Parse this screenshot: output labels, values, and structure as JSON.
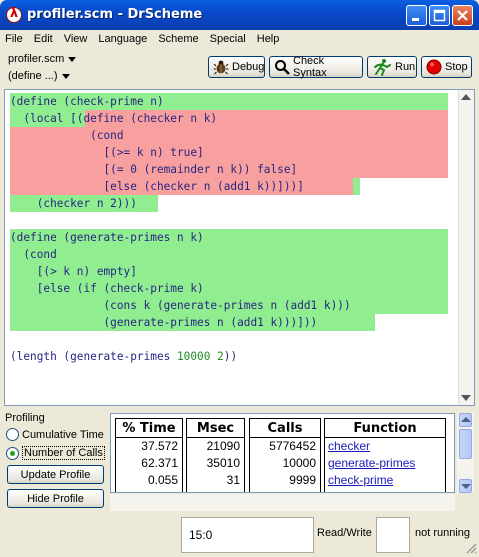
{
  "window": {
    "title": "profiler.scm - DrScheme"
  },
  "menu": [
    "File",
    "Edit",
    "View",
    "Language",
    "Scheme",
    "Special",
    "Help"
  ],
  "toolbar": {
    "file_dropdown": "profiler.scm",
    "define_dropdown": "(define ...)",
    "debug_label": "Debug",
    "check_syntax_label": "Check Syntax",
    "run_label": "Run",
    "stop_label": "Stop"
  },
  "colors": {
    "covered": "#90ee90",
    "uncovered": "#f8a0a0",
    "code_text": "#262680",
    "number_text": "#228b22"
  },
  "code_lines": [
    "(define (check-prime n)",
    "  (local [(define (checker n k)",
    "            (cond",
    "              [(>= k n) true]",
    "              [(= 0 (remainder n k)) false]",
    "              [else (checker n (add1 k))]))]",
    "    (checker n 2)))",
    "",
    "(define (generate-primes n k)",
    "  (cond",
    "    [(> k n) empty]",
    "    [else (if (check-prime k)",
    "              (cons k (generate-primes n (add1 k)))",
    "              (generate-primes n (add1 k)))]))",
    "",
    "(length (generate-primes 10000 2))"
  ],
  "profiling": {
    "title": "Profiling",
    "options": [
      "Cumulative Time",
      "Number of Calls"
    ],
    "selected": "Number of Calls",
    "update_label": "Update Profile",
    "hide_label": "Hide Profile",
    "headers": [
      "% Time",
      "Msec",
      "Calls",
      "Function"
    ],
    "rows": [
      {
        "pct": "37.572",
        "msec": "21090",
        "calls": "5776452",
        "fn": "checker"
      },
      {
        "pct": "62.371",
        "msec": "35010",
        "calls": "10000",
        "fn": "generate-primes"
      },
      {
        "pct": "0.055",
        "msec": "31",
        "calls": "9999",
        "fn": "check-prime"
      }
    ]
  },
  "status": {
    "position": "15:0",
    "mode": "Read/Write",
    "state": "not running"
  }
}
